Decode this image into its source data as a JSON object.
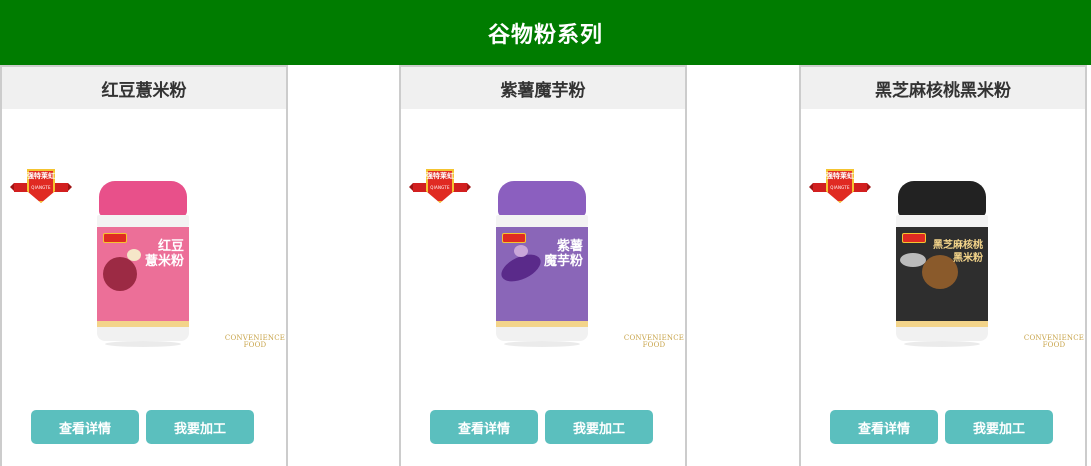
{
  "header": {
    "title": "谷物粉系列"
  },
  "products": [
    {
      "name": "红豆薏米粉",
      "jar_label": "红豆\n薏米粉",
      "lid_color": "#e8508a",
      "band_color": "#ec6f98",
      "band_accent": "#d94f7c",
      "conv_text": "CONVENIENCE\nFOOD",
      "detail_button": "查看详情",
      "process_button": "我要加工"
    },
    {
      "name": "紫薯魔芋粉",
      "jar_label": "紫薯\n魔芋粉",
      "lid_color": "#8b5fbf",
      "band_color": "#8a66b8",
      "band_accent": "#6f4aa0",
      "conv_text": "CONVENIENCE\nFOOD",
      "detail_button": "查看详情",
      "process_button": "我要加工"
    },
    {
      "name": "黑芝麻核桃黑米粉",
      "jar_label": "黑芝麻核桃\n黑米粉",
      "lid_color": "#222222",
      "band_color": "#2e2e2e",
      "band_accent": "#444444",
      "conv_text": "CONVENIENCE\nFOOD",
      "detail_button": "查看详情",
      "process_button": "我要加工"
    }
  ],
  "brand": {
    "badge_text": "强特莱虹",
    "badge_sub": "QIANGTE"
  }
}
